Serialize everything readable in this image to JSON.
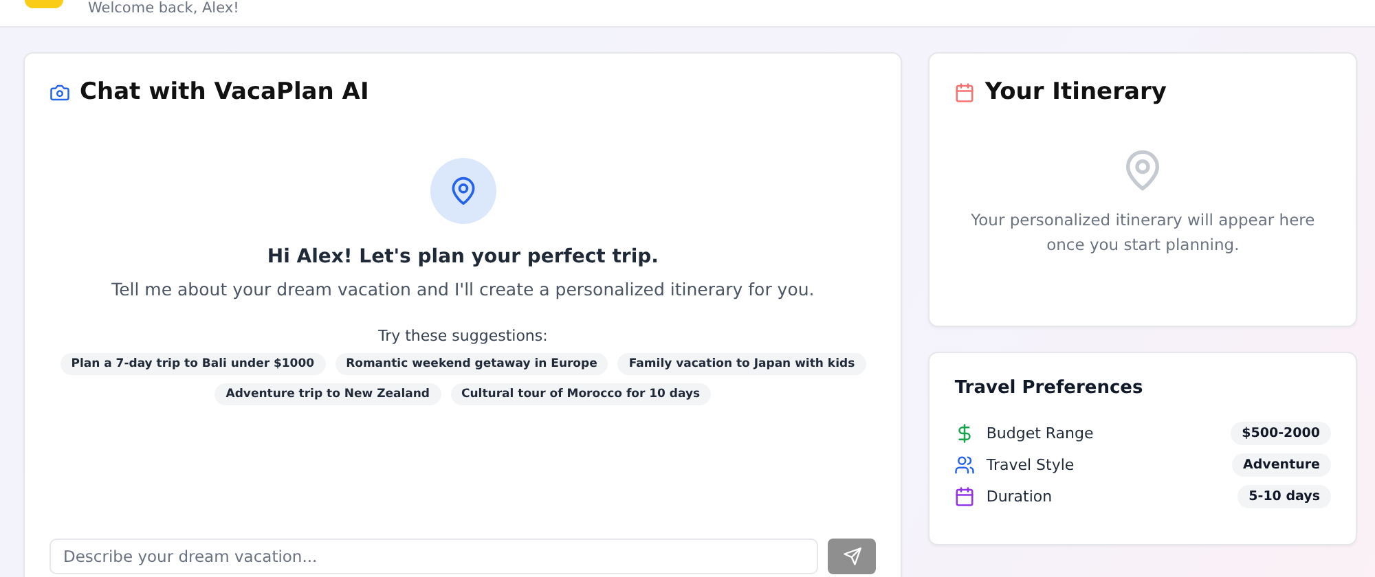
{
  "header": {
    "greeting": "Welcome back, Alex!"
  },
  "chat": {
    "title": "Chat with VacaPlan AI",
    "heading": "Hi Alex! Let's plan your perfect trip.",
    "intro": "Tell me about your dream vacation and I'll create a personalized itinerary for you.",
    "suggestions_label": "Try these suggestions:",
    "suggestions": [
      "Plan a 7-day trip to Bali under $1000",
      "Romantic weekend getaway in Europe",
      "Family vacation to Japan with kids",
      "Adventure trip to New Zealand",
      "Cultural tour of Morocco for 10 days"
    ],
    "input": {
      "placeholder": "Describe your dream vacation...",
      "send_disabled": true
    }
  },
  "itinerary": {
    "title": "Your Itinerary",
    "empty_message": "Your personalized itinerary will appear here once you start planning."
  },
  "preferences": {
    "title": "Travel Preferences",
    "items": [
      {
        "kind": "budget",
        "label": "Budget Range",
        "value": "$500-2000",
        "color": "#16a34a"
      },
      {
        "kind": "style",
        "label": "Travel Style",
        "value": "Adventure",
        "color": "#2563eb"
      },
      {
        "kind": "duration",
        "label": "Duration",
        "value": "5-10 days",
        "color": "#9333ea"
      }
    ]
  }
}
